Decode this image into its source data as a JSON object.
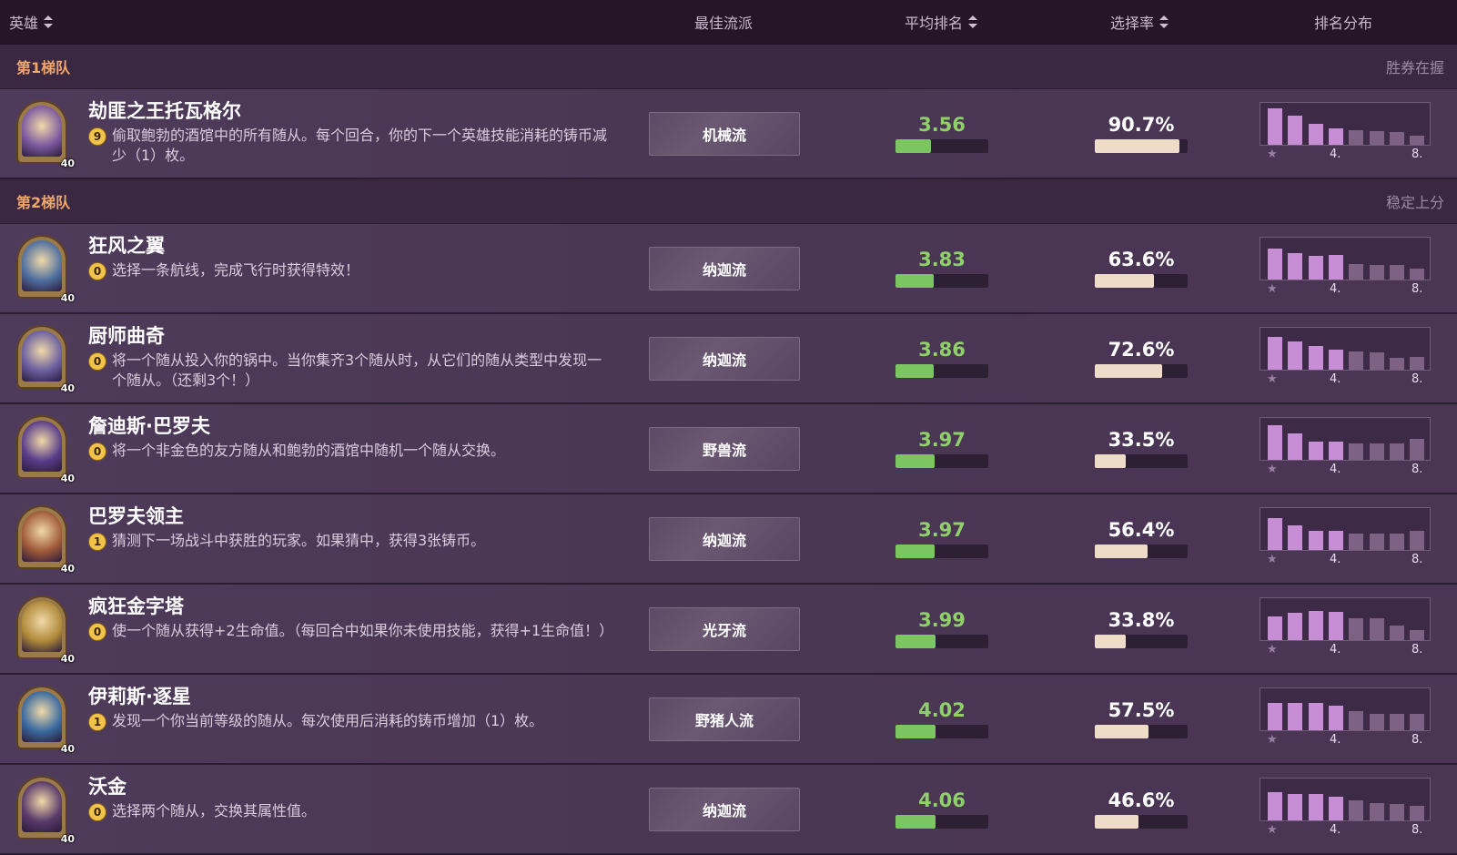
{
  "header": {
    "hero": "英雄",
    "best_comp": "最佳流派",
    "avg_rank": "平均排名",
    "pick_rate": "选择率",
    "rank_dist": "排名分布"
  },
  "tiers": [
    {
      "name": "第1梯队",
      "desc": "胜券在握"
    },
    {
      "name": "第2梯队",
      "desc": "稳定上分"
    }
  ],
  "heroes": [
    {
      "name": "劫匪之王托瓦格尔",
      "cost": "9",
      "power": "偷取鲍勃的酒馆中的所有随从。每个回合，你的下一个英雄技能消耗的铸币减少（1）枚。",
      "comp": "机械流",
      "avg": "3.56",
      "avg_pct": 0.38,
      "pick": "90.7%",
      "pick_pct": 0.907,
      "level": "40",
      "dist": [
        0.92,
        0.72,
        0.52,
        0.42,
        0.36,
        0.34,
        0.32,
        0.22
      ],
      "color": "#7d5aa0"
    },
    {
      "name": "狂风之翼",
      "cost": "0",
      "power": "选择一条航线，完成飞行时获得特效！",
      "comp": "纳迦流",
      "avg": "3.83",
      "avg_pct": 0.41,
      "pick": "63.6%",
      "pick_pct": 0.636,
      "level": "40",
      "dist": [
        0.78,
        0.66,
        0.58,
        0.62,
        0.38,
        0.36,
        0.36,
        0.28
      ],
      "color": "#4f6fa0"
    },
    {
      "name": "厨师曲奇",
      "cost": "0",
      "power": "将一个随从投入你的锅中。当你集齐3个随从时，从它们的随从类型中发现一个随从。（还剩3个！）",
      "comp": "纳迦流",
      "avg": "3.86",
      "avg_pct": 0.41,
      "pick": "72.6%",
      "pick_pct": 0.726,
      "level": "40",
      "dist": [
        0.82,
        0.7,
        0.58,
        0.5,
        0.46,
        0.44,
        0.3,
        0.32
      ],
      "color": "#6b5fa0"
    },
    {
      "name": "詹迪斯·巴罗夫",
      "cost": "0",
      "power": "将一个非金色的友方随从和鲍勃的酒馆中随机一个随从交换。",
      "comp": "野兽流",
      "avg": "3.97",
      "avg_pct": 0.42,
      "pick": "33.5%",
      "pick_pct": 0.335,
      "level": "40",
      "dist": [
        0.86,
        0.66,
        0.46,
        0.46,
        0.4,
        0.4,
        0.42,
        0.52
      ],
      "color": "#5a3d8a"
    },
    {
      "name": "巴罗夫领主",
      "cost": "1",
      "power": "猜测下一场战斗中获胜的玩家。如果猜中，获得3张铸币。",
      "comp": "纳迦流",
      "avg": "3.97",
      "avg_pct": 0.42,
      "pick": "56.4%",
      "pick_pct": 0.564,
      "level": "40",
      "dist": [
        0.8,
        0.62,
        0.48,
        0.48,
        0.42,
        0.4,
        0.4,
        0.48
      ],
      "color": "#a05a3a"
    },
    {
      "name": "疯狂金字塔",
      "cost": "0",
      "power": "使一个随从获得+2生命值。（每回合中如果你未使用技能，获得+1生命值！）",
      "comp": "光牙流",
      "avg": "3.99",
      "avg_pct": 0.43,
      "pick": "33.8%",
      "pick_pct": 0.338,
      "level": "40",
      "dist": [
        0.6,
        0.68,
        0.72,
        0.7,
        0.54,
        0.54,
        0.36,
        0.24
      ],
      "color": "#b08a3a"
    },
    {
      "name": "伊莉斯·逐星",
      "cost": "1",
      "power": "发现一个你当前等级的随从。每次使用后消耗的铸币增加（1）枚。",
      "comp": "野猪人流",
      "avg": "4.02",
      "avg_pct": 0.43,
      "pick": "57.5%",
      "pick_pct": 0.575,
      "level": "40",
      "dist": [
        0.68,
        0.68,
        0.68,
        0.62,
        0.48,
        0.42,
        0.4,
        0.4
      ],
      "color": "#3a6aa0"
    },
    {
      "name": "沃金",
      "cost": "0",
      "power": "选择两个随从，交换其属性值。",
      "comp": "纳迦流",
      "avg": "4.06",
      "avg_pct": 0.43,
      "pick": "46.6%",
      "pick_pct": 0.466,
      "level": "40",
      "dist": [
        0.7,
        0.66,
        0.66,
        0.6,
        0.5,
        0.44,
        0.4,
        0.36
      ],
      "color": "#5a3a6a"
    }
  ],
  "dist_labels": {
    "first": "★",
    "mid": "4.",
    "last": "8."
  }
}
